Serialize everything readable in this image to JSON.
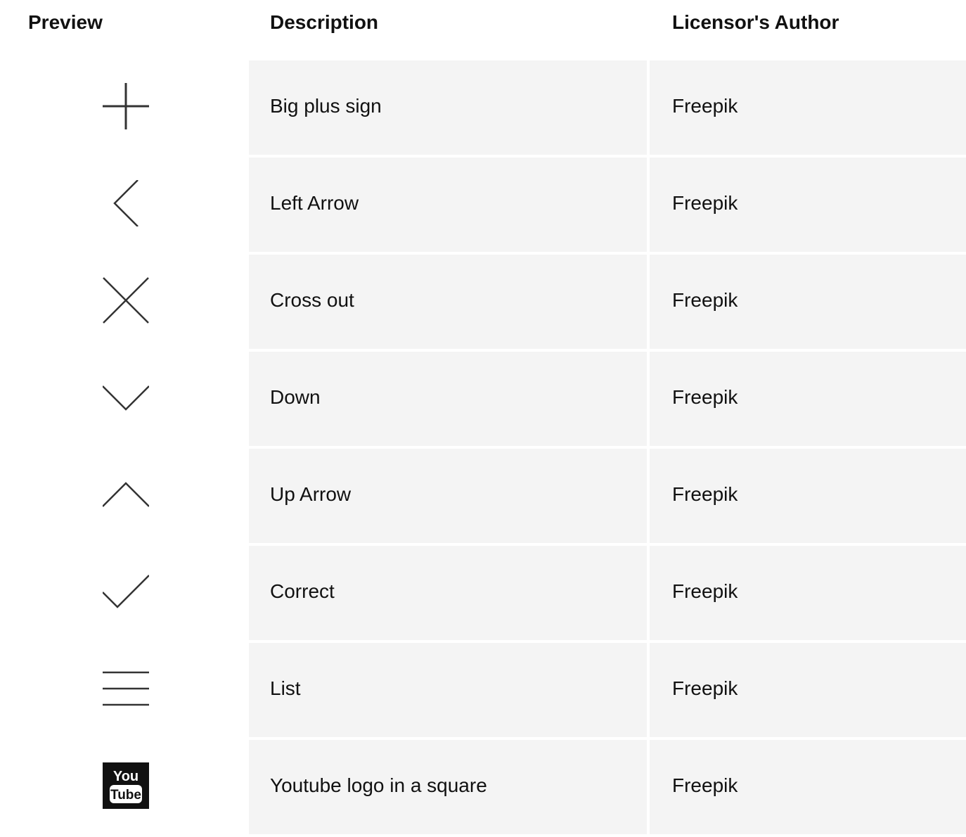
{
  "headers": {
    "preview": "Preview",
    "description": "Description",
    "author": "Licensor's Author"
  },
  "rows": [
    {
      "icon": "plus-icon",
      "description": "Big plus sign",
      "author": "Freepik"
    },
    {
      "icon": "chevron-left-icon",
      "description": "Left Arrow",
      "author": "Freepik"
    },
    {
      "icon": "cross-icon",
      "description": "Cross out",
      "author": "Freepik"
    },
    {
      "icon": "chevron-down-icon",
      "description": "Down",
      "author": "Freepik"
    },
    {
      "icon": "chevron-up-icon",
      "description": "Up Arrow",
      "author": "Freepik"
    },
    {
      "icon": "checkmark-icon",
      "description": "Correct",
      "author": "Freepik"
    },
    {
      "icon": "list-icon",
      "description": "List",
      "author": "Freepik"
    },
    {
      "icon": "youtube-square-icon",
      "description": "Youtube logo in a square",
      "author": "Freepik",
      "logo_text": [
        "You",
        "Tube"
      ]
    }
  ],
  "colors": {
    "icon_stroke": "#333333",
    "row_background": "#f4f4f4",
    "text": "#111111"
  }
}
